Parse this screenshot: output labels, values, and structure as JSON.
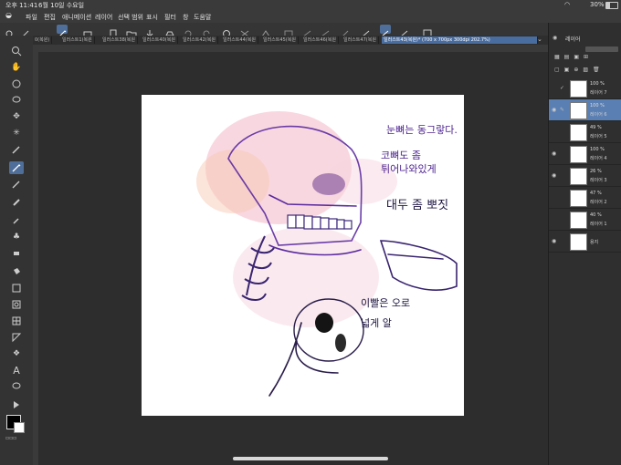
{
  "status_bar": {
    "time": "오후 11:41",
    "date": "6월 10일 수요일",
    "battery": "30%"
  },
  "menu": [
    "파일",
    "편집",
    "애니메이션",
    "레이어",
    "선택 범위",
    "표시",
    "필터",
    "창",
    "도움말"
  ],
  "tabs": [
    {
      "label": "0(복원)"
    },
    {
      "label": "일러스트1(복원"
    },
    {
      "label": "일러스트38(복원"
    },
    {
      "label": "일러스트40(복원"
    },
    {
      "label": "일러스트42(복원"
    },
    {
      "label": "일러스트44(복원"
    },
    {
      "label": "일러스트45(복원"
    },
    {
      "label": "일러스트46(복원"
    },
    {
      "label": "일러스트47(복원"
    },
    {
      "label": "일러스트43(복원)* (700 x 700px 300dpi 202.7%)",
      "active": true
    }
  ],
  "canvas_text": {
    "note1": "눈뼈는 동그랗다.",
    "note2": "코뼈도 좀",
    "note3": "튀어나와있게",
    "note4": "대두 좀 뽀짓",
    "note5": "이빨은 오로",
    "note6": "넓게 알"
  },
  "layers_panel": {
    "title": "레이어",
    "layers": [
      {
        "opacity": "100 %",
        "blend": "표준",
        "name": "레이어 7",
        "visible": false,
        "selected": false
      },
      {
        "opacity": "100 %",
        "blend": "표준",
        "name": "레이어 6",
        "visible": true,
        "selected": true
      },
      {
        "opacity": "49 %",
        "blend": "표준",
        "name": "레이어 5",
        "visible": false,
        "selected": false
      },
      {
        "opacity": "100 %",
        "blend": "표준",
        "name": "레이어 4",
        "visible": true,
        "selected": false
      },
      {
        "opacity": "26 %",
        "blend": "표준",
        "name": "레이어 3",
        "visible": true,
        "selected": false
      },
      {
        "opacity": "47 %",
        "blend": "표준",
        "name": "레이어 2",
        "visible": false,
        "selected": false
      },
      {
        "opacity": "40 %",
        "blend": "표준",
        "name": "레이어 1",
        "visible": false,
        "selected": false
      },
      {
        "opacity": "",
        "blend": "",
        "name": "용지",
        "visible": true,
        "selected": false
      }
    ]
  },
  "colors": {
    "accent": "#4f6f9a",
    "selection": "#5a7fb3",
    "ink": "#4a1f8e",
    "pink": "#f3b6c8"
  }
}
